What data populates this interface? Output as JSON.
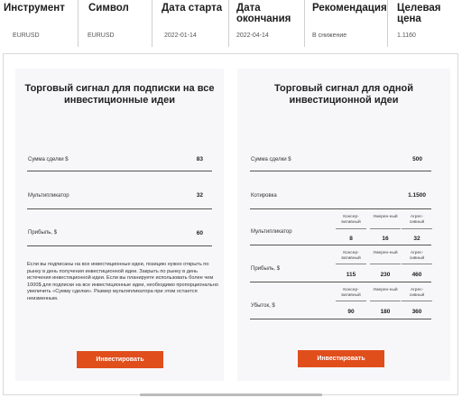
{
  "table": {
    "headers": [
      "Инструмент",
      "Символ",
      "Дата старта",
      "Дата окончания",
      "Рекомендация",
      "Целевая цена"
    ],
    "values": [
      "EURUSD",
      "EURUSD",
      "2022-01-14",
      "2022-04-14",
      "В снижение",
      "1.1160"
    ]
  },
  "panel_all": {
    "title": "Торговый сигнал для подписки на все инвестиционные идеи",
    "rows": [
      {
        "label": "Сумма сделки $",
        "value": "83"
      },
      {
        "label": "Мультипликатор",
        "value": "32"
      },
      {
        "label": "Прибыль, $",
        "value": "60"
      }
    ],
    "description": "Если вы подписаны на все инвестиционные идеи, позицию нужно открыть по рынку в день получения инвестиционной идеи. Закрыть по рынку в день истечения инвестиционной идеи. Если вы планируете использовать более чем 1000$ для подписки на все инвестиционные идеи, необходимо пропорционально увеличить «Сумму сделки». Размер мультипликатора при этом остается неизменным.",
    "button": "Инвестировать"
  },
  "panel_one": {
    "title": "Торговый сигнал для одной инвестиционной идеи",
    "amount": {
      "label": "Сумма сделки $",
      "value": "500"
    },
    "quote": {
      "label": "Котировка",
      "value": "1.1500"
    },
    "levels": [
      "Консер-ватив­ный",
      "Умерен-ный",
      "Агрес-сивный"
    ],
    "multiplier": {
      "label": "Мультипликатор",
      "values": [
        "8",
        "16",
        "32"
      ]
    },
    "profit": {
      "label": "Прибыль, $",
      "values": [
        "115",
        "230",
        "460"
      ]
    },
    "loss": {
      "label": "Убыток, $",
      "values": [
        "90",
        "180",
        "360"
      ]
    },
    "button": "Инвестировать"
  },
  "colors": {
    "accent": "#e04e1c",
    "panel_bg": "#f7f7fa"
  }
}
